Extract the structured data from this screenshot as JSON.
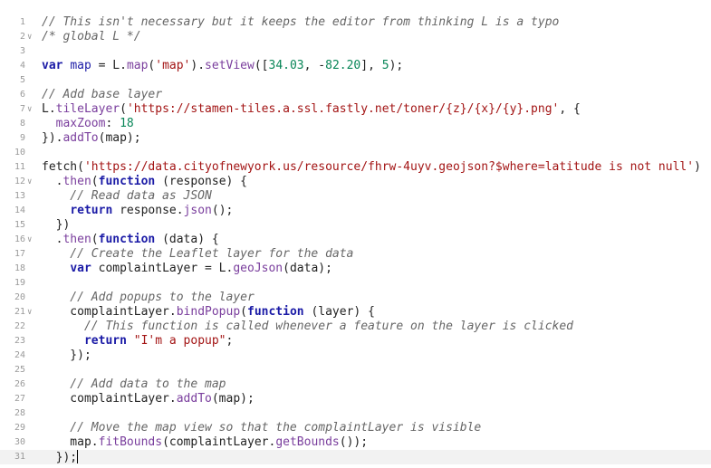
{
  "editor": {
    "lines": [
      {
        "num": "1",
        "fold": false,
        "text": "// This isn't necessary but it keeps the editor from thinking L is a typo"
      },
      {
        "num": "2",
        "fold": true,
        "text": "/* global L */"
      },
      {
        "num": "3",
        "fold": false,
        "text": ""
      },
      {
        "num": "4",
        "fold": false,
        "text": "var map = L.map('map').setView([34.03, -82.20], 5);"
      },
      {
        "num": "5",
        "fold": false,
        "text": ""
      },
      {
        "num": "6",
        "fold": false,
        "text": "// Add base layer"
      },
      {
        "num": "7",
        "fold": true,
        "text": "L.tileLayer('https://stamen-tiles.a.ssl.fastly.net/toner/{z}/{x}/{y}.png', {"
      },
      {
        "num": "8",
        "fold": false,
        "text": "  maxZoom: 18"
      },
      {
        "num": "9",
        "fold": false,
        "text": "}).addTo(map);"
      },
      {
        "num": "10",
        "fold": false,
        "text": ""
      },
      {
        "num": "11",
        "fold": false,
        "text": "fetch('https://data.cityofnewyork.us/resource/fhrw-4uyv.geojson?$where=latitude is not null')"
      },
      {
        "num": "12",
        "fold": true,
        "text": "  .then(function (response) {"
      },
      {
        "num": "13",
        "fold": false,
        "text": "    // Read data as JSON"
      },
      {
        "num": "14",
        "fold": false,
        "text": "    return response.json();"
      },
      {
        "num": "15",
        "fold": false,
        "text": "  })"
      },
      {
        "num": "16",
        "fold": true,
        "text": "  .then(function (data) {"
      },
      {
        "num": "17",
        "fold": false,
        "text": "    // Create the Leaflet layer for the data"
      },
      {
        "num": "18",
        "fold": false,
        "text": "    var complaintLayer = L.geoJson(data);"
      },
      {
        "num": "19",
        "fold": false,
        "text": ""
      },
      {
        "num": "20",
        "fold": false,
        "text": "    // Add popups to the layer"
      },
      {
        "num": "21",
        "fold": true,
        "text": "    complaintLayer.bindPopup(function (layer) {"
      },
      {
        "num": "22",
        "fold": false,
        "text": "      // This function is called whenever a feature on the layer is clicked"
      },
      {
        "num": "23",
        "fold": false,
        "text": "      return \"I'm a popup\";"
      },
      {
        "num": "24",
        "fold": false,
        "text": "    });"
      },
      {
        "num": "25",
        "fold": false,
        "text": ""
      },
      {
        "num": "26",
        "fold": false,
        "text": "    // Add data to the map"
      },
      {
        "num": "27",
        "fold": false,
        "text": "    complaintLayer.addTo(map);"
      },
      {
        "num": "28",
        "fold": false,
        "text": ""
      },
      {
        "num": "29",
        "fold": false,
        "text": "    // Move the map view so that the complaintLayer is visible"
      },
      {
        "num": "30",
        "fold": false,
        "text": "    map.fitBounds(complaintLayer.getBounds());"
      },
      {
        "num": "31",
        "fold": false,
        "text": "  });"
      }
    ],
    "active_line": "31",
    "fold_icon": "chevron-down-icon"
  }
}
